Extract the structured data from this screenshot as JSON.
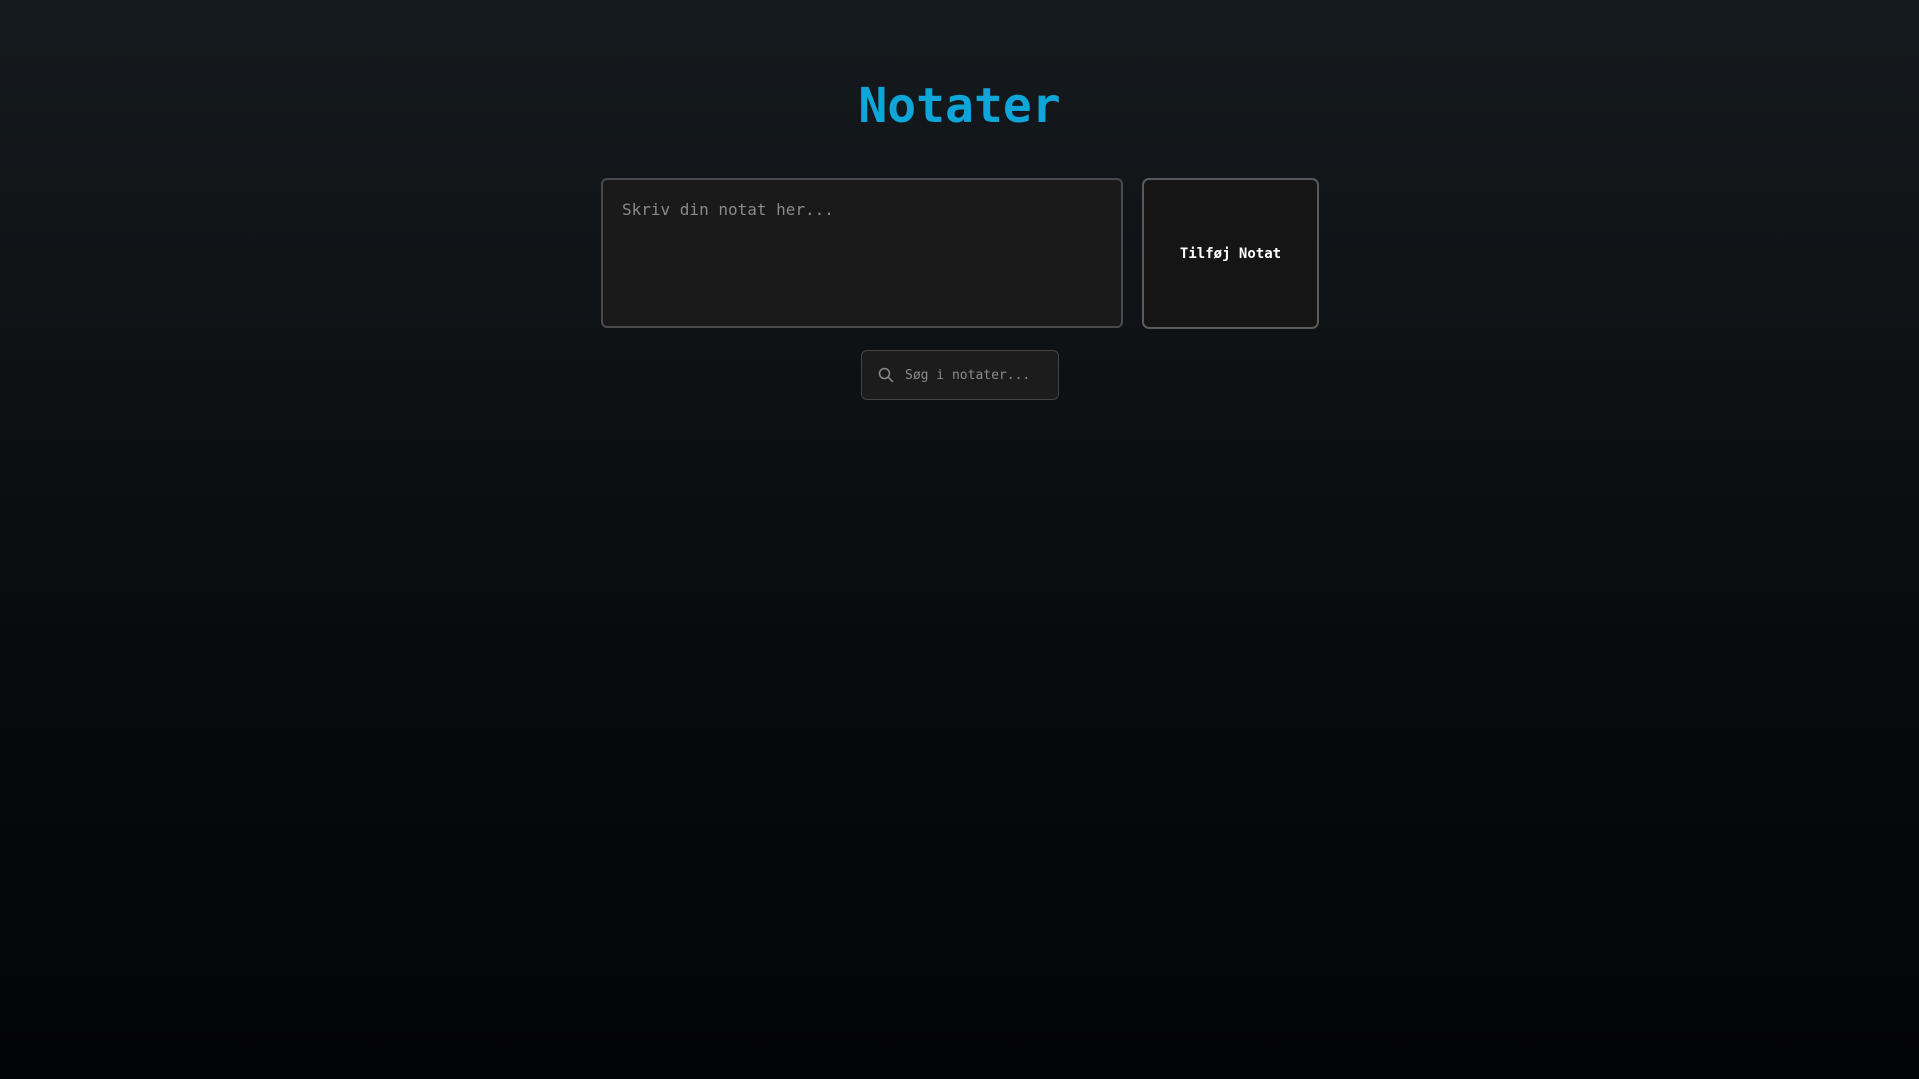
{
  "header": {
    "title": "Notater"
  },
  "composer": {
    "note_placeholder": "Skriv din notat her...",
    "note_value": "",
    "add_button_label": "Tilføj Notat"
  },
  "search": {
    "placeholder": "Søg i notater...",
    "value": "",
    "icon": "search-icon"
  },
  "colors": {
    "accent": "#0ea5d8",
    "background_top": "#151a1e",
    "background_bottom": "#030405"
  }
}
